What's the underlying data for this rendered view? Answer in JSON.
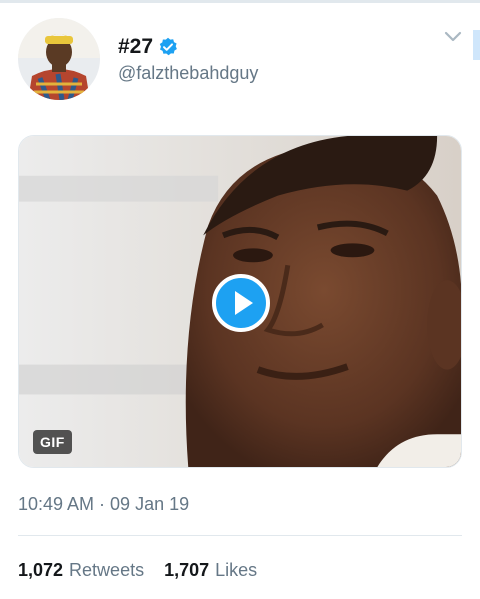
{
  "tweet": {
    "author": {
      "display_name": "#27",
      "handle": "@falzthebahdguy",
      "verified": true
    },
    "media": {
      "type": "gif",
      "badge": "GIF"
    },
    "timestamp": "10:49 AM · 09 Jan 19",
    "stats": {
      "retweets_count": "1,072",
      "retweets_label": "Retweets",
      "likes_count": "1,707",
      "likes_label": "Likes"
    }
  },
  "icons": {
    "verified": "verified-badge-icon",
    "play": "play-icon",
    "menu": "chevron-down-icon"
  },
  "colors": {
    "accent": "#1da1f2",
    "secondary_text": "#657786",
    "primary_text": "#14171a",
    "divider": "#e1e8ed"
  }
}
